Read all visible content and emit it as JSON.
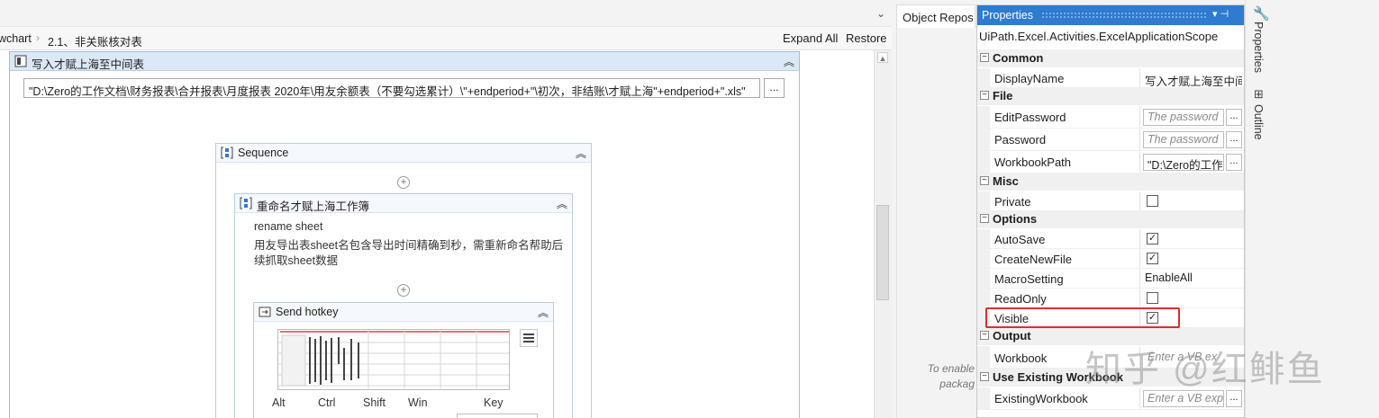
{
  "designer": {
    "breadcrumb": [
      "wchart",
      "2.1、非关账核对表"
    ],
    "expand_all": "Expand All",
    "restore": "Restore"
  },
  "activities": {
    "excel_scope": {
      "title": "写入才赋上海至中间表",
      "workbook_path": "\"D:\\Zero的工作文档\\财务报表\\合并报表\\月度报表 2020年\\用友余额表（不要勾选累计）\\\"+endperiod+\"\\初次，非结账\\才赋上海\"+endperiod+\".xls\"",
      "browse_label": "..."
    },
    "sequence": {
      "title": "Sequence"
    },
    "rename_sequence": {
      "title": "重命名才赋上海工作簿",
      "annotation_title": "rename sheet",
      "annotation_line1": "用友导出表sheet名包含导出时间精确到秒，需重新命名帮助后",
      "annotation_line2": "续抓取sheet数据"
    },
    "send_hotkey": {
      "title": "Send hotkey",
      "modifiers": [
        "Alt",
        "Ctrl",
        "Shift",
        "Win"
      ],
      "key_label": "Key"
    }
  },
  "object_repository": {
    "tab_label": "Object Repos",
    "hint_line1": "To enable",
    "hint_line2": "packag"
  },
  "properties": {
    "title": "Properties",
    "pin_controls": "▾ ⊣",
    "activity_type": "UiPath.Excel.Activities.ExcelApplicationScope",
    "categories": {
      "common": "Common",
      "file": "File",
      "misc": "Misc",
      "options": "Options",
      "output": "Output",
      "use_existing": "Use Existing Workbook"
    },
    "rows": {
      "display_name": {
        "name": "DisplayName",
        "value": "写入才赋上海至中间"
      },
      "edit_password": {
        "name": "EditPassword",
        "placeholder": "The password"
      },
      "password": {
        "name": "Password",
        "placeholder": "The password"
      },
      "workbook_path": {
        "name": "WorkbookPath",
        "value": "\"D:\\Zero的工作"
      },
      "private": {
        "name": "Private",
        "checked": false
      },
      "auto_save": {
        "name": "AutoSave",
        "checked": true
      },
      "create_new_file": {
        "name": "CreateNewFile",
        "checked": true
      },
      "macro_setting": {
        "name": "MacroSetting",
        "value": "EnableAll"
      },
      "read_only": {
        "name": "ReadOnly",
        "checked": false
      },
      "visible": {
        "name": "Visible",
        "checked": true
      },
      "workbook": {
        "name": "Workbook",
        "placeholder": "Enter a VB ex"
      },
      "existing_workbook": {
        "name": "ExistingWorkbook",
        "placeholder": "Enter a VB exp"
      }
    },
    "ellipsis": "..."
  },
  "side_tabs": {
    "properties": "Properties",
    "outline": "Outline"
  },
  "watermark": "知乎 @红鲱鱼",
  "colors": {
    "accent": "#2e7bd0",
    "highlight": "#d9302c"
  }
}
